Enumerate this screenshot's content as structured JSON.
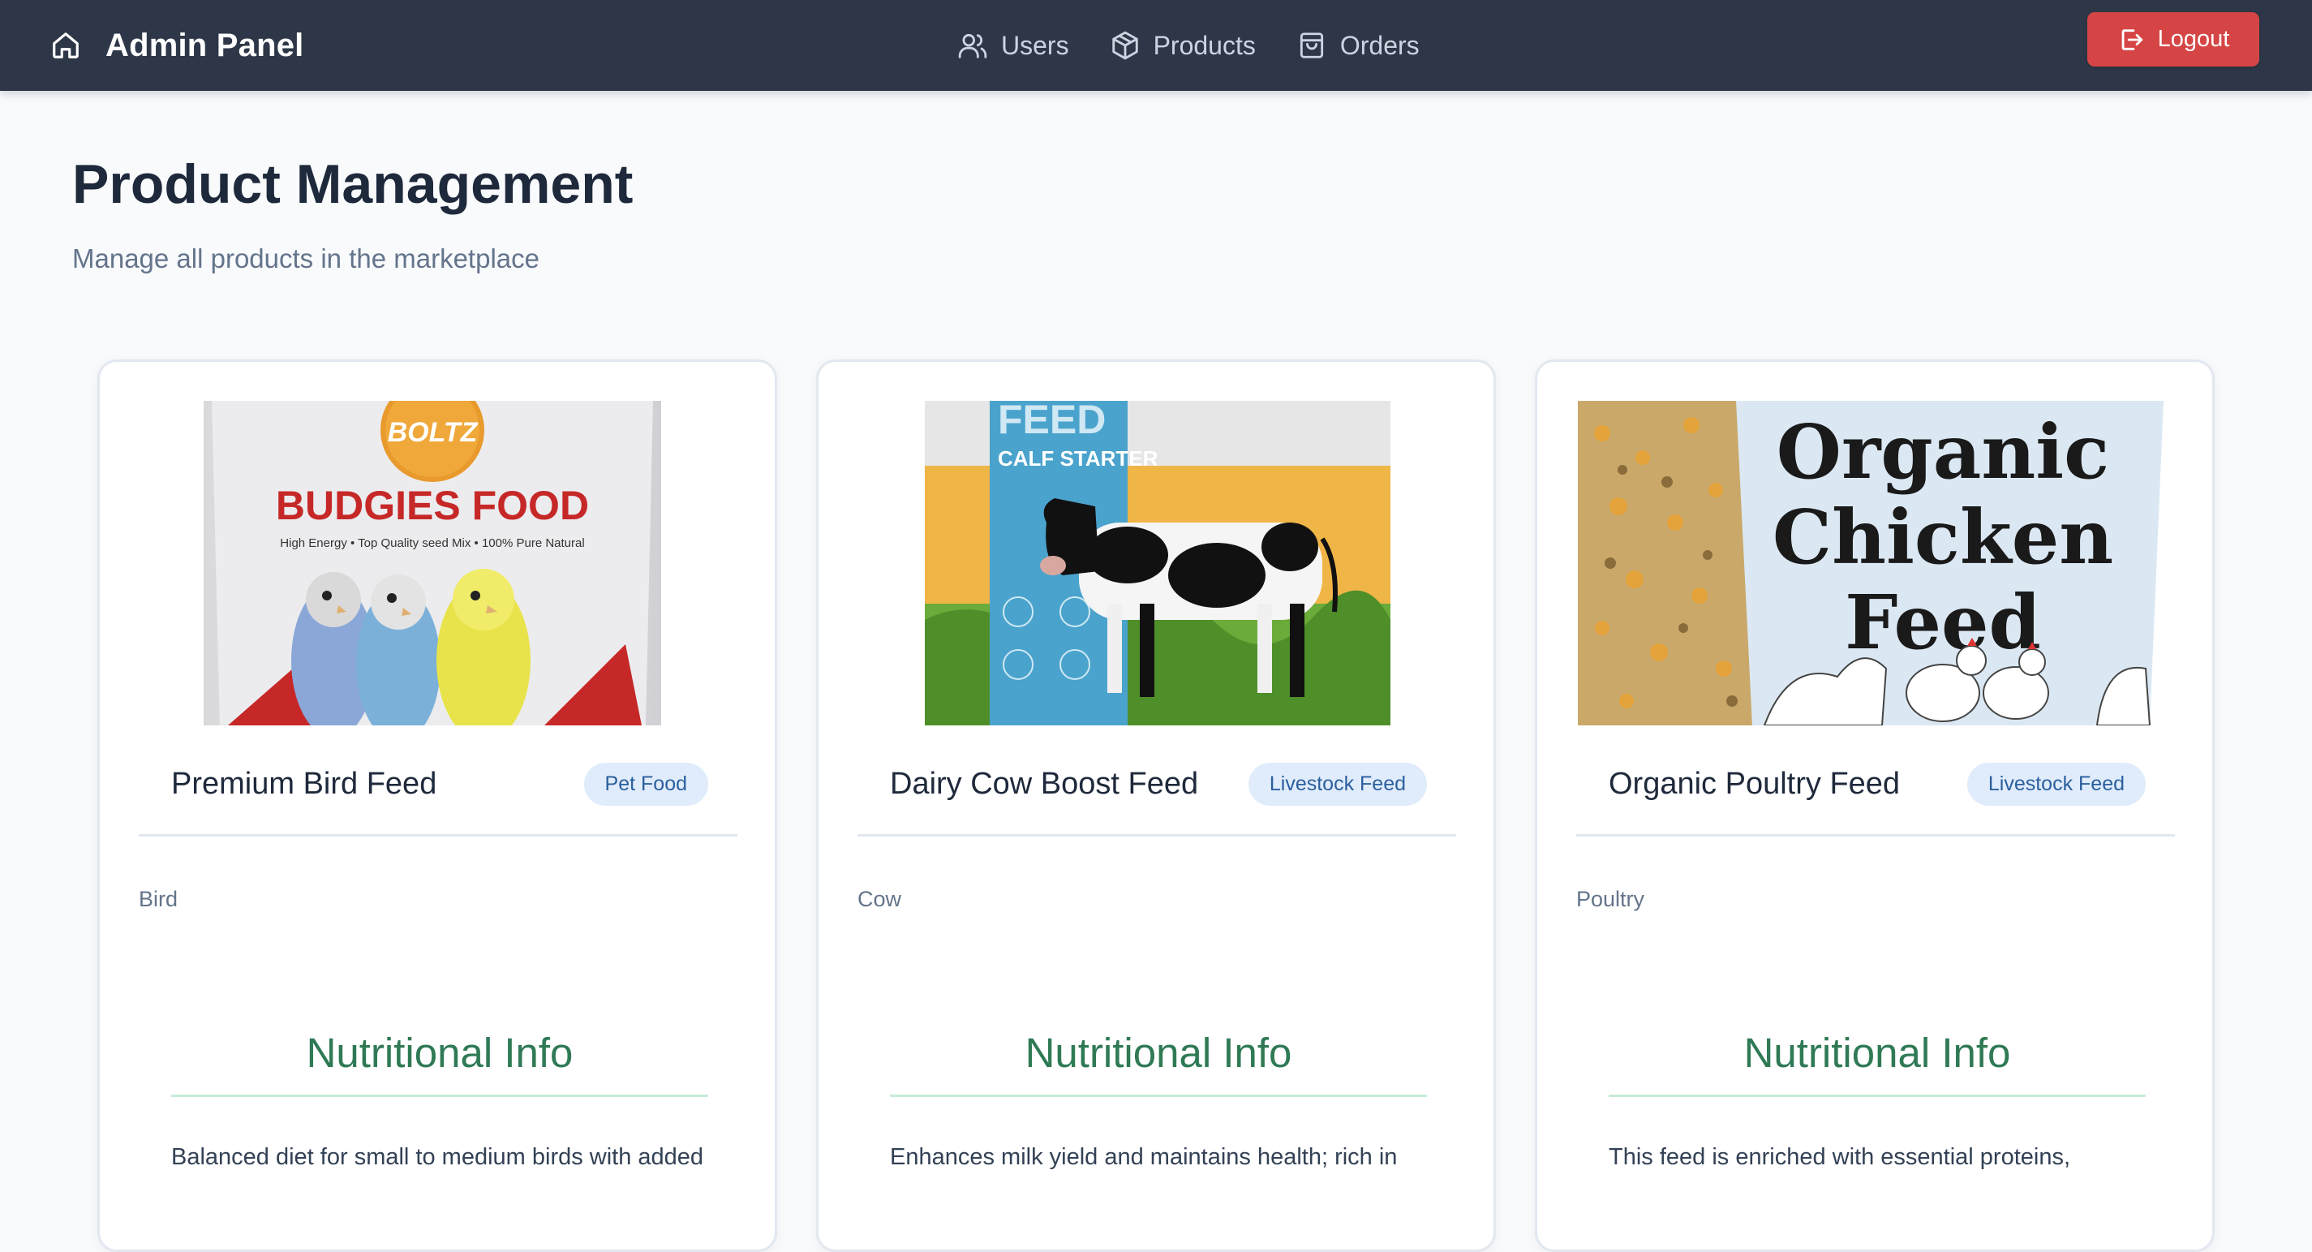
{
  "navbar": {
    "brand": "Admin Panel",
    "brand_icon": "home-icon",
    "links": [
      {
        "label": "Users",
        "icon": "users-icon"
      },
      {
        "label": "Products",
        "icon": "box-icon"
      },
      {
        "label": "Orders",
        "icon": "shopping-bag-icon"
      }
    ],
    "logout_label": "Logout",
    "logout_icon": "logout-icon",
    "colors": {
      "bar": "#2d3748",
      "logout": "#d64545"
    }
  },
  "page": {
    "title": "Product Management",
    "subtitle": "Manage all products in the marketplace"
  },
  "products": [
    {
      "name": "Premium Bird Feed",
      "category": "Pet Food",
      "animal": "Bird",
      "nutrition_heading": "Nutritional Info",
      "description": "Balanced diet for small to medium birds with added",
      "image_text": {
        "brand": "BOLTZ",
        "product": "BUDGIES FOOD",
        "tagline": "High Energy •  Top Quality seed Mix • 100% Pure Natural"
      }
    },
    {
      "name": "Dairy Cow Boost Feed",
      "category": "Livestock Feed",
      "animal": "Cow",
      "nutrition_heading": "Nutritional Info",
      "description": "Enhances milk yield and maintains health; rich in",
      "image_text": {
        "brand": "FEED",
        "product": "CALF STARTER"
      }
    },
    {
      "name": "Organic Poultry Feed",
      "category": "Livestock Feed",
      "animal": "Poultry",
      "nutrition_heading": "Nutritional Info",
      "description": "This feed is enriched with essential proteins,",
      "image_text": {
        "line1": "Organic",
        "line2": "Chicken",
        "line3": "Feed"
      }
    }
  ]
}
